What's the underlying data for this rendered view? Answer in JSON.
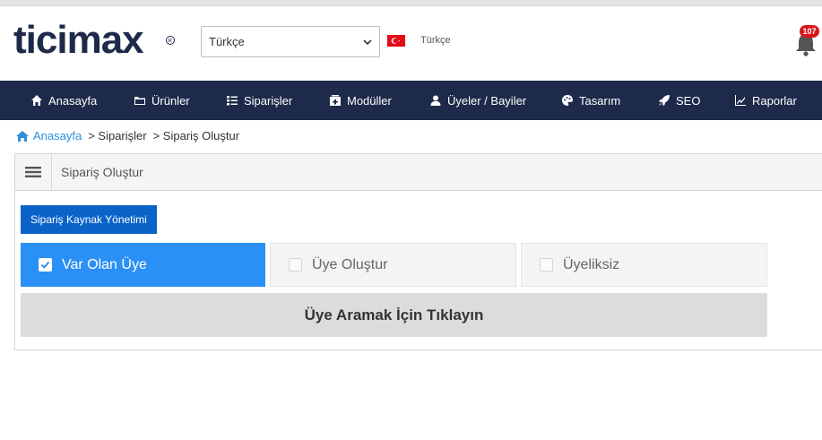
{
  "header": {
    "logo_text": "ticimax",
    "language_select": {
      "selected": "Türkçe"
    },
    "language_label": "Türkçe",
    "notifications": {
      "count": "107"
    }
  },
  "nav": {
    "items": [
      {
        "label": "Anasayfa",
        "icon": "home-icon"
      },
      {
        "label": "Ürünler",
        "icon": "folder-icon"
      },
      {
        "label": "Siparişler",
        "icon": "list-icon"
      },
      {
        "label": "Modüller",
        "icon": "module-icon"
      },
      {
        "label": "Üyeler / Bayiler",
        "icon": "user-icon"
      },
      {
        "label": "Tasarım",
        "icon": "palette-icon"
      },
      {
        "label": "SEO",
        "icon": "rocket-icon"
      },
      {
        "label": "Raporlar",
        "icon": "chart-icon"
      }
    ]
  },
  "breadcrumb": {
    "home": "Anasayfa",
    "items": [
      "> Siparişler",
      "> Sipariş Oluştur"
    ]
  },
  "panel": {
    "title": "Sipariş Oluştur",
    "source_button": "Sipariş Kaynak Yönetimi",
    "options": [
      {
        "label": "Var Olan Üye",
        "checked": true
      },
      {
        "label": "Üye Oluştur",
        "checked": false
      },
      {
        "label": "Üyeliksiz",
        "checked": false
      }
    ],
    "search_prompt": "Üye Aramak İçin Tıklayın"
  },
  "colors": {
    "nav_bg": "#1e2a4a",
    "accent": "#2b90f5",
    "button": "#0b63c9",
    "link": "#2f8fdc",
    "badge": "#d9161c"
  }
}
